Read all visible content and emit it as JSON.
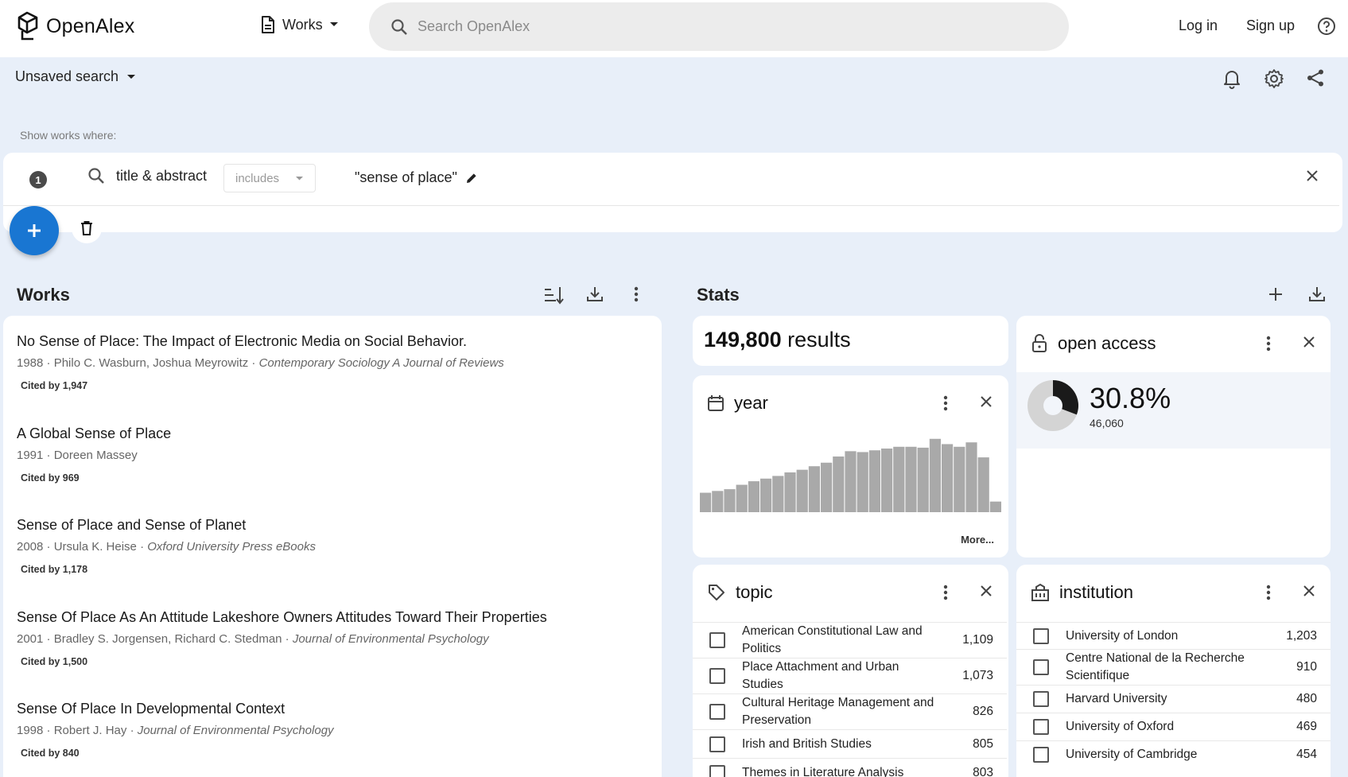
{
  "header": {
    "logo_text": "OpenAlex",
    "entity_label": "Works",
    "search_placeholder": "Search OpenAlex",
    "login_label": "Log in",
    "signup_label": "Sign up"
  },
  "saved_search": {
    "label": "Unsaved search"
  },
  "filter": {
    "show_label": "Show works where:",
    "index": "1",
    "field": "title & abstract",
    "operator": "includes",
    "value": "\"sense of place\""
  },
  "works": {
    "title": "Works",
    "items": [
      {
        "title": "No Sense of Place: The Impact of Electronic Media on Social Behavior.",
        "year_authors": "1988 · Philo C. Wasburn, Joshua Meyrowitz · ",
        "venue": "Contemporary Sociology A Journal of Reviews",
        "cited": "Cited by 1,947"
      },
      {
        "title": "A Global Sense of Place",
        "year_authors": "1991 · Doreen Massey",
        "venue": "",
        "cited": "Cited by 969"
      },
      {
        "title": "Sense of Place and Sense of Planet",
        "year_authors": "2008 · Ursula K. Heise · ",
        "venue": "Oxford University Press eBooks",
        "cited": "Cited by 1,178"
      },
      {
        "title": "Sense Of Place As An Attitude Lakeshore Owners Attitudes Toward Their Properties",
        "year_authors": "2001 · Bradley S. Jorgensen, Richard C. Stedman · ",
        "venue": "Journal of Environmental Psychology",
        "cited": "Cited by 1,500"
      },
      {
        "title": "Sense Of Place In Developmental Context",
        "year_authors": "1998 · Robert J. Hay · ",
        "venue": "Journal of Environmental Psychology",
        "cited": "Cited by 840"
      }
    ]
  },
  "stats": {
    "title": "Stats",
    "results_count": "149,800",
    "results_suffix": "results",
    "year_card": {
      "title": "year",
      "more_label": "More..."
    },
    "open_access_card": {
      "title": "open access",
      "percent": "30.8%",
      "count": "46,060",
      "fraction": 0.308
    },
    "topic_card": {
      "title": "topic",
      "rows": [
        {
          "label": "American Constitutional Law and Politics",
          "count": "1,109"
        },
        {
          "label": "Place Attachment and Urban Studies",
          "count": "1,073"
        },
        {
          "label": "Cultural Heritage Management and Preservation",
          "count": "826"
        },
        {
          "label": "Irish and British Studies",
          "count": "805"
        },
        {
          "label": "Themes in Literature Analysis",
          "count": "803"
        }
      ]
    },
    "institution_card": {
      "title": "institution",
      "rows": [
        {
          "label": "University of London",
          "count": "1,203"
        },
        {
          "label": "Centre National de la Recherche Scientifique",
          "count": "910"
        },
        {
          "label": "Harvard University",
          "count": "480"
        },
        {
          "label": "University of Oxford",
          "count": "469"
        },
        {
          "label": "University of Cambridge",
          "count": "454"
        }
      ]
    }
  },
  "chart_data": {
    "type": "bar",
    "values": [
      22,
      24,
      26,
      31,
      35,
      38,
      41,
      45,
      48,
      52,
      56,
      63,
      69,
      68,
      70,
      72,
      74,
      74,
      73,
      83,
      77,
      74,
      79,
      62,
      12
    ],
    "ylim": [
      0,
      90
    ],
    "grid": false,
    "color": "#a9a9a9"
  }
}
